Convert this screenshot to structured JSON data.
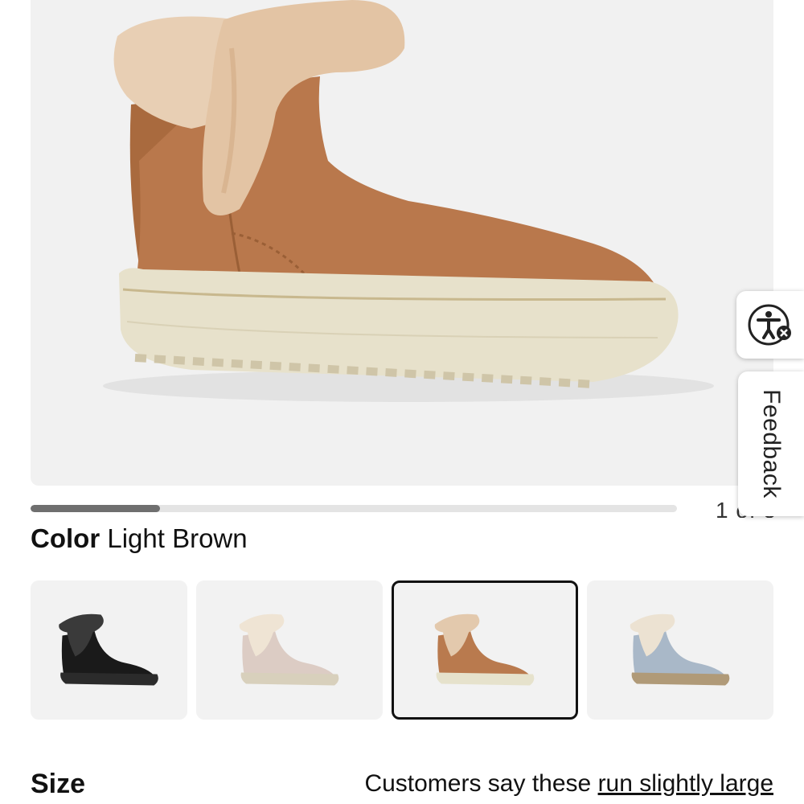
{
  "product": {
    "image_alt": "Light brown suede winter bootie with shearling cuff",
    "carousel_progress": 0.2,
    "carousel_counter": "1 of 5"
  },
  "color": {
    "label": "Color",
    "selected_value": "Light Brown",
    "swatches": [
      {
        "name": "Black",
        "selected": false,
        "upper": "#1a1a1a",
        "fur": "#3a3a3a",
        "sole": "#2b2b2b"
      },
      {
        "name": "Beige",
        "selected": false,
        "upper": "#dcccc4",
        "fur": "#efe4d4",
        "sole": "#d8d0bc"
      },
      {
        "name": "Light Brown",
        "selected": true,
        "upper": "#b97a4e",
        "fur": "#e3c9ad",
        "sole": "#e6e2cc"
      },
      {
        "name": "Light Blue",
        "selected": false,
        "upper": "#a9b8c8",
        "fur": "#ece2d2",
        "sole": "#b09a78"
      }
    ]
  },
  "size": {
    "label": "Size",
    "fit_prefix": "Customers say these ",
    "fit_link": "run slightly large"
  },
  "widgets": {
    "accessibility_icon": "accessibility-icon",
    "feedback_label": "Feedback"
  }
}
